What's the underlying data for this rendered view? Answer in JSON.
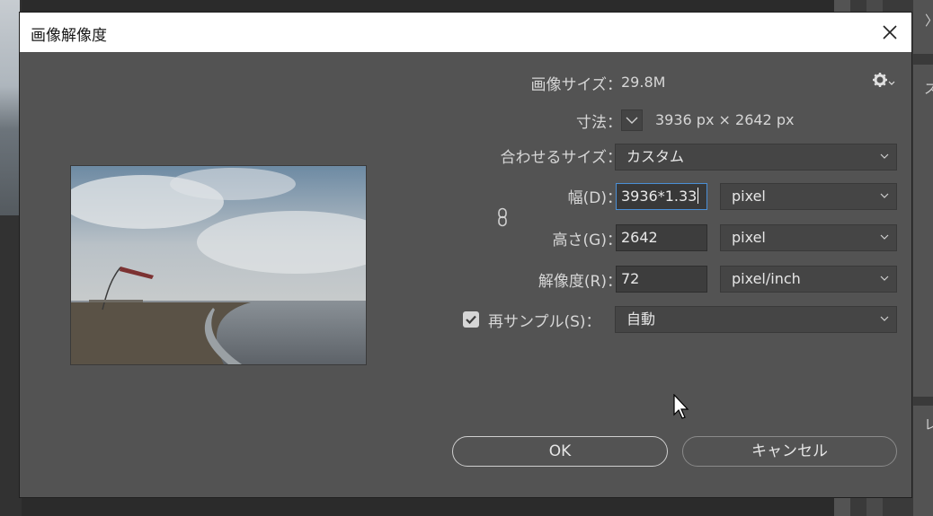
{
  "background_panel": {
    "label_1": "〉",
    "label_2": "ス",
    "label_3": "レ"
  },
  "dialog": {
    "title": "画像解像度",
    "image_size": {
      "label": "画像サイズ：",
      "value": "29.8M"
    },
    "dimensions": {
      "label": "寸法：",
      "value": "3936 px × 2642 px"
    },
    "fit_to": {
      "label": "合わせるサイズ：",
      "value": "カスタム"
    },
    "width": {
      "label": "幅(D)：",
      "value": "3936*1.33",
      "unit": "pixel"
    },
    "height": {
      "label": "高さ(G)：",
      "value": "2642",
      "unit": "pixel"
    },
    "resolution": {
      "label": "解像度(R)：",
      "value": "72",
      "unit": "pixel/inch"
    },
    "resample": {
      "label": "再サンプル(S)：",
      "checked": true,
      "value": "自動"
    },
    "ok_label": "OK",
    "cancel_label": "キャンセル"
  },
  "icons": [
    "close-icon",
    "gear-icon",
    "chevron-down-icon",
    "link-icon",
    "checkmark-icon",
    "mouse-cursor-icon"
  ]
}
